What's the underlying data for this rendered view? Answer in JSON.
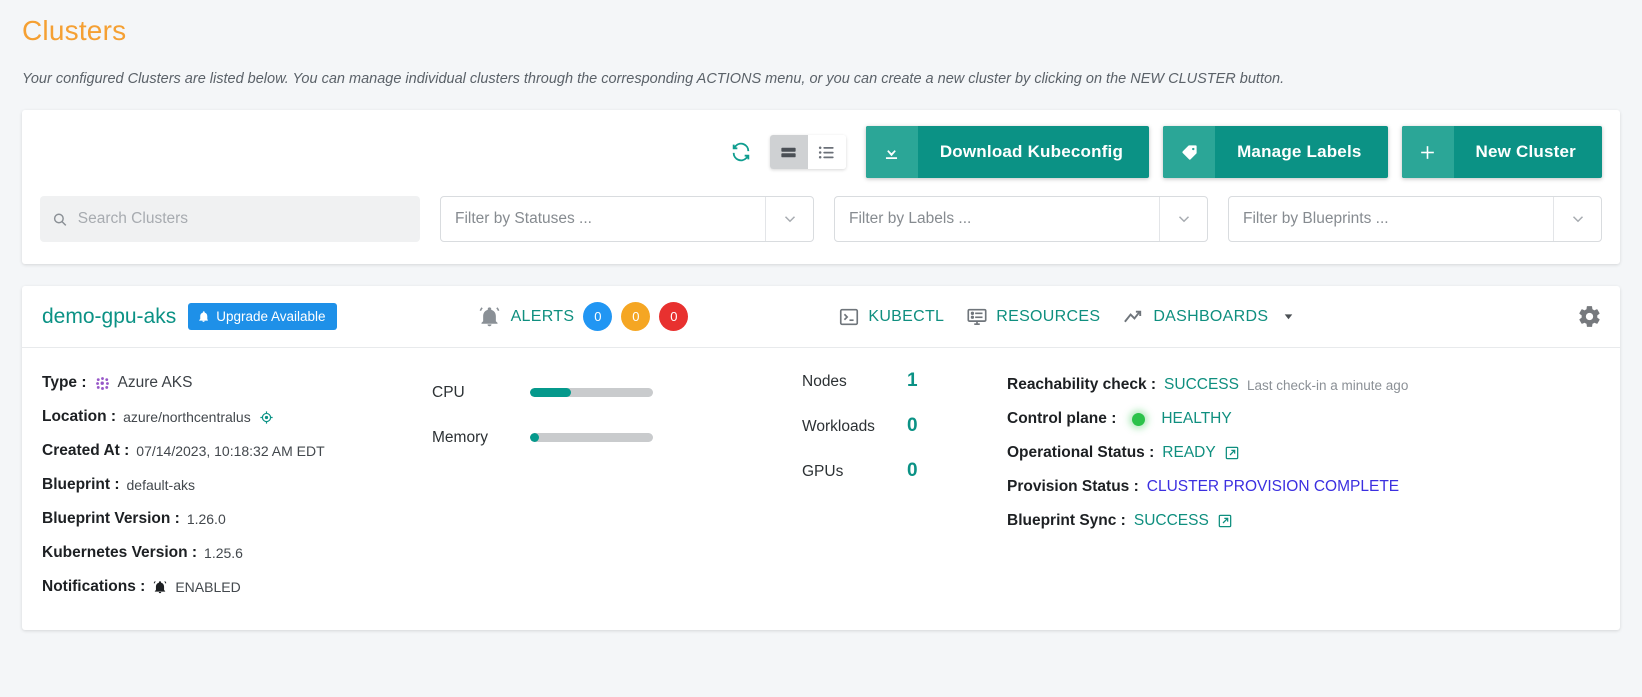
{
  "page": {
    "title": "Clusters",
    "subtitle": "Your configured Clusters are listed below. You can manage individual clusters through the corresponding ACTIONS menu, or you can create a new cluster by clicking on the NEW CLUSTER button."
  },
  "toolbar": {
    "refresh_icon": "refresh-icon",
    "view_card_icon": "card-view-icon",
    "view_list_icon": "list-view-icon",
    "buttons": [
      {
        "label": "Download Kubeconfig",
        "icon": "download-icon"
      },
      {
        "label": "Manage Labels",
        "icon": "tag-icon"
      },
      {
        "label": "New Cluster",
        "icon": "plus-icon"
      }
    ]
  },
  "filters": {
    "search_placeholder": "Search Clusters",
    "search_value": "",
    "statuses": "Filter by Statuses ...",
    "labels": "Filter by Labels ...",
    "blueprints": "Filter by Blueprints ..."
  },
  "cluster": {
    "name": "demo-gpu-aks",
    "upgrade_badge": "Upgrade Available",
    "alerts_label": "ALERTS",
    "alerts": [
      {
        "count": "0",
        "severity": "info"
      },
      {
        "count": "0",
        "severity": "warning"
      },
      {
        "count": "0",
        "severity": "critical"
      }
    ],
    "actions": [
      {
        "label": "KUBECTL",
        "icon": "terminal-icon"
      },
      {
        "label": "RESOURCES",
        "icon": "resources-icon"
      },
      {
        "label": "DASHBOARDS",
        "icon": "trend-up-icon"
      }
    ],
    "settings_icon": "gear-icon",
    "details": [
      {
        "key": "Type :",
        "value": "Azure AKS",
        "icon": "azure-aks-icon"
      },
      {
        "key": "Location :",
        "value": "azure/northcentralus",
        "icon": "location-target-icon"
      },
      {
        "key": "Created At :",
        "value": "07/14/2023, 10:18:32 AM EDT"
      },
      {
        "key": "Blueprint :",
        "value": "default-aks"
      },
      {
        "key": "Blueprint Version :",
        "value": "1.26.0"
      },
      {
        "key": "Kubernetes Version :",
        "value": "1.25.6"
      },
      {
        "key": "Notifications :",
        "value": "ENABLED",
        "icon": "bell-icon"
      }
    ],
    "usage": [
      {
        "label": "CPU",
        "percent": 33
      },
      {
        "label": "Memory",
        "percent": 4
      }
    ],
    "counts": [
      {
        "label": "Nodes",
        "value": "1"
      },
      {
        "label": "Workloads",
        "value": "0"
      },
      {
        "label": "GPUs",
        "value": "0"
      }
    ],
    "status": [
      {
        "key": "Reachability check :",
        "value": "SUCCESS",
        "meta": "Last check-in  a minute ago"
      },
      {
        "key": "Control plane :",
        "value": "HEALTHY",
        "dot": true
      },
      {
        "key": "Operational Status :",
        "value": "READY",
        "external": true
      },
      {
        "key": "Provision Status :",
        "value": "CLUSTER PROVISION COMPLETE",
        "link": true
      },
      {
        "key": "Blueprint Sync :",
        "value": "SUCCESS",
        "external": true
      }
    ]
  },
  "colors": {
    "accent_teal": "#0b9285",
    "title_orange": "#f5a033",
    "badge_blue": "#1e90e8",
    "link_blue": "#3b2fe0",
    "alert_info": "#2196f3",
    "alert_warning": "#f5a623",
    "alert_critical": "#e8312f",
    "healthy_green": "#2bc24a"
  }
}
